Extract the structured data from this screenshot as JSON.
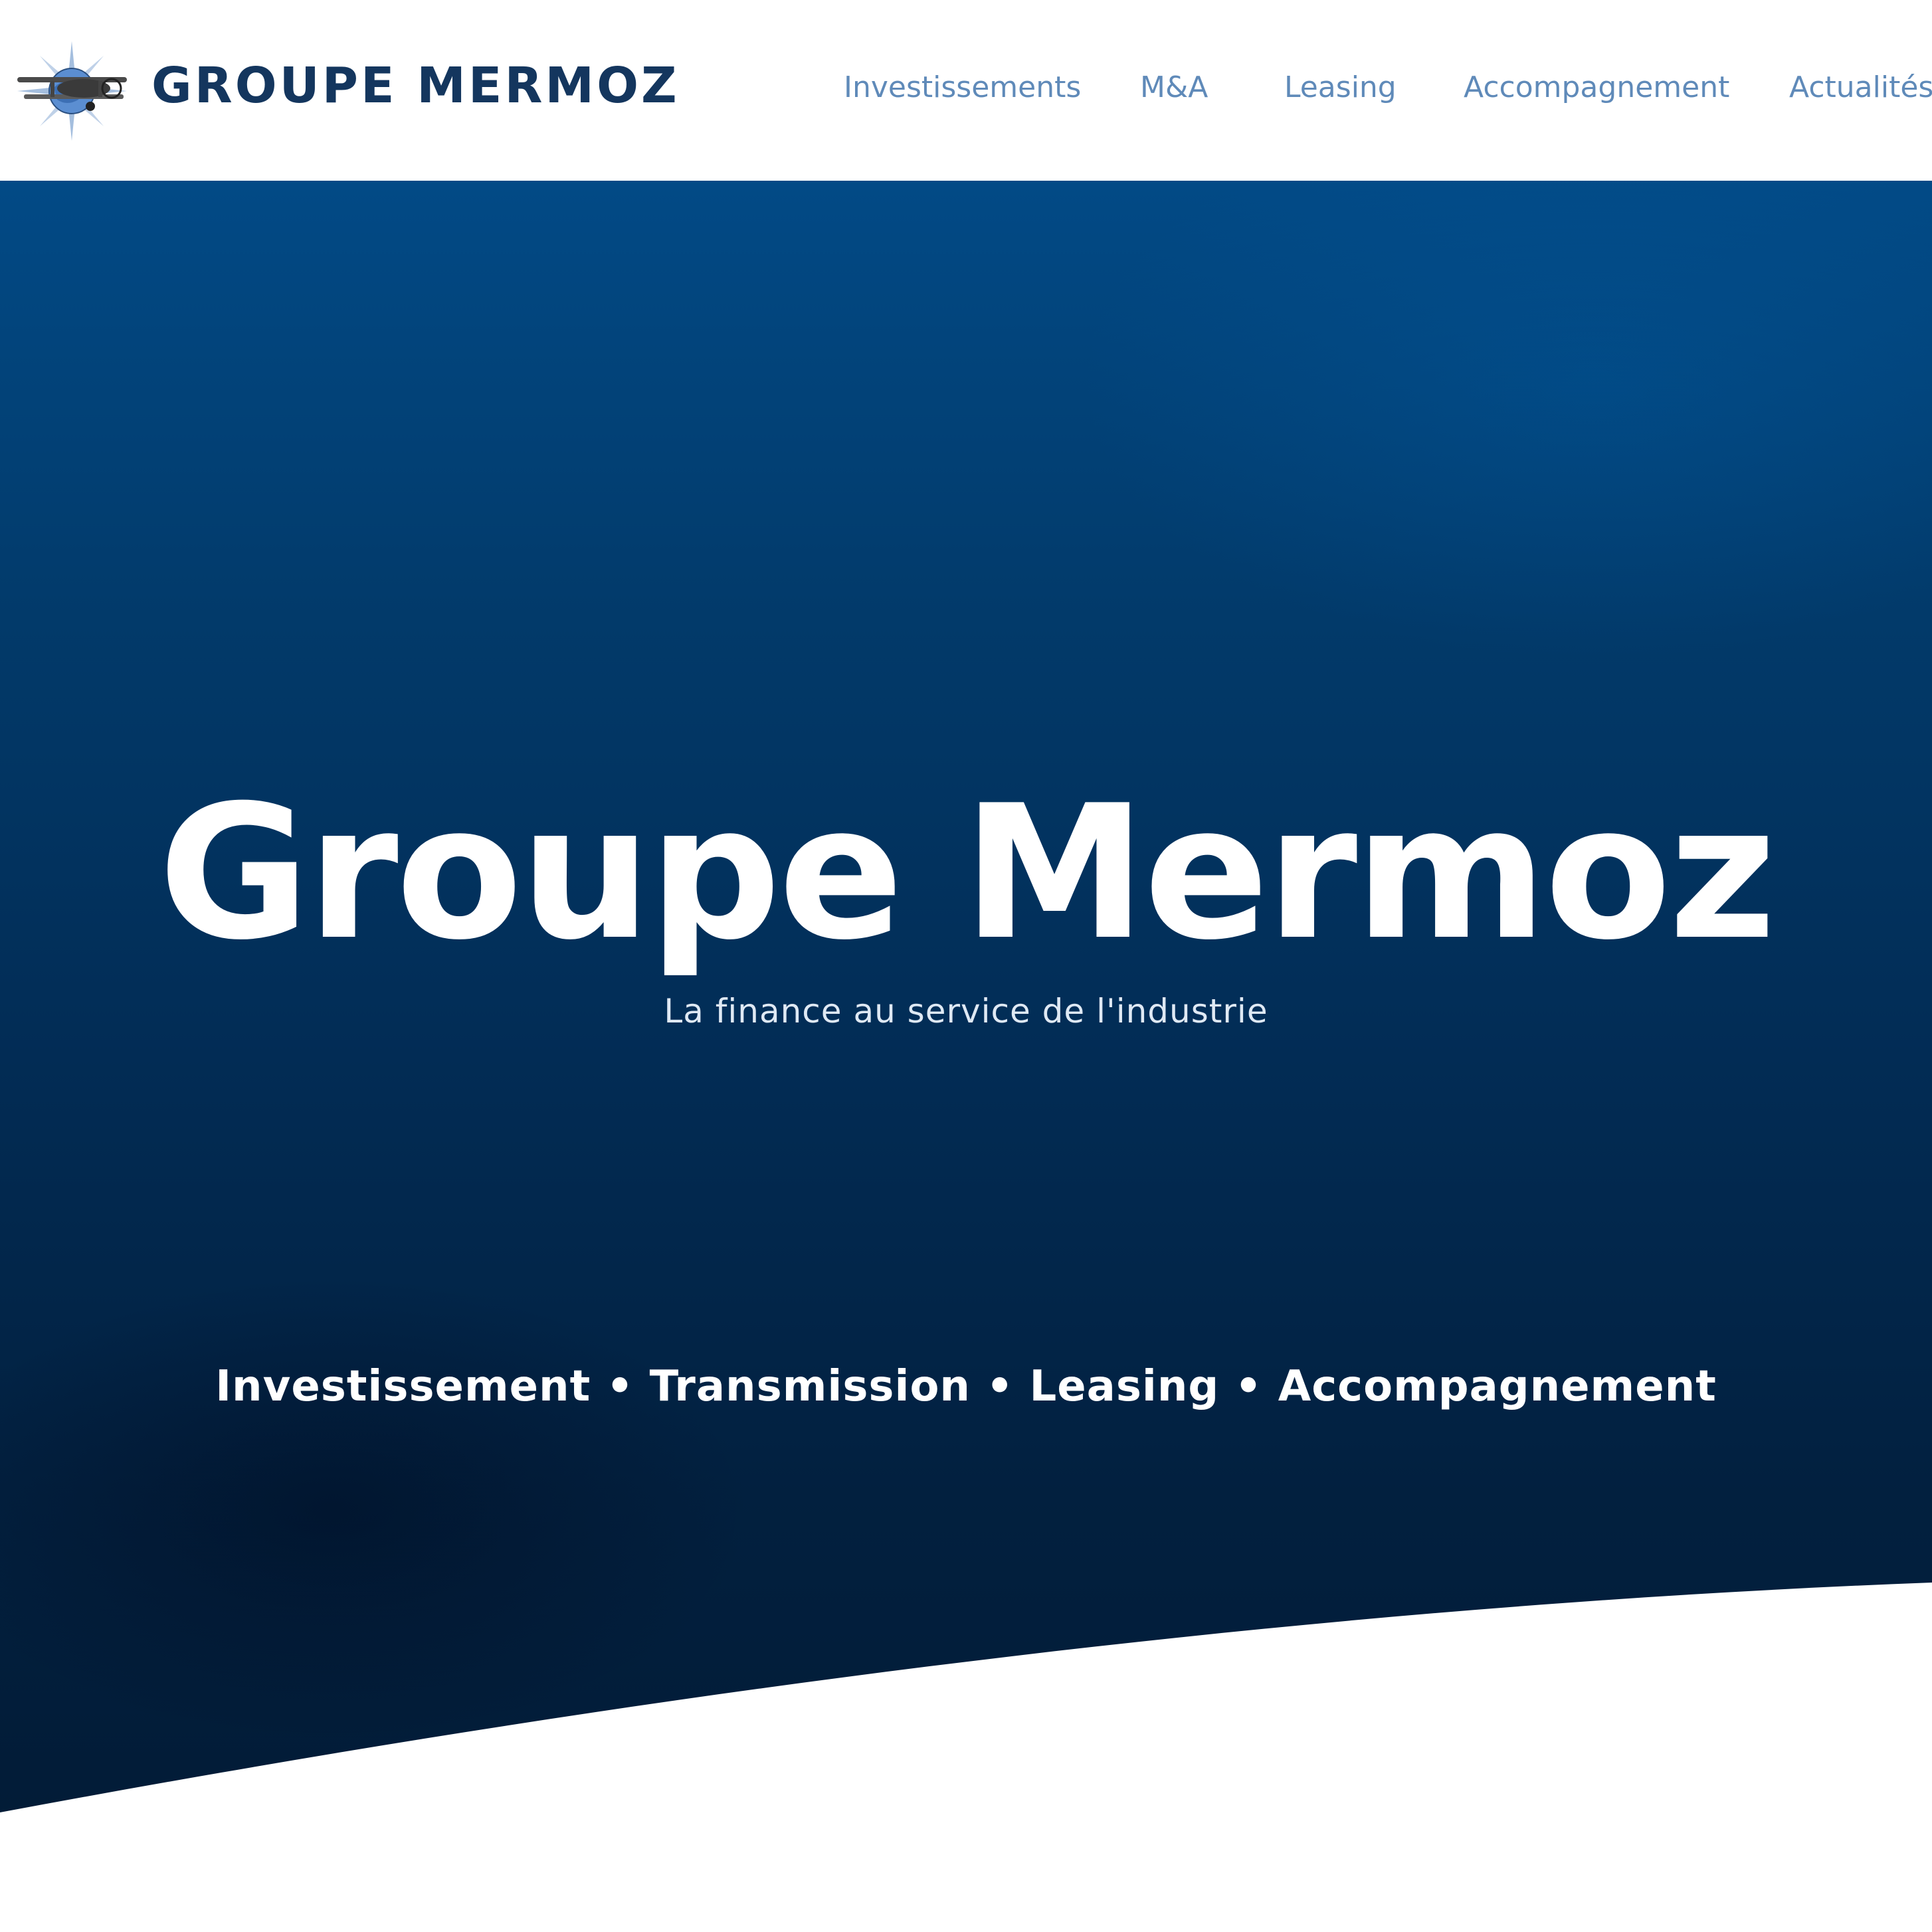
{
  "header": {
    "brand": "GROUPE MERMOZ",
    "logo_icon": "biplane-compass-icon",
    "nav": [
      {
        "label": "Investissements"
      },
      {
        "label": "M&A"
      },
      {
        "label": "Leasing"
      },
      {
        "label": "Accompagnement"
      },
      {
        "label": "Actualités"
      }
    ]
  },
  "hero": {
    "title": "Groupe Mermoz",
    "subtitle": "La finance au service de l'industrie",
    "services": "Investissement • Transmission • Leasing • Accompagnement"
  },
  "colors": {
    "brand_navy": "#14365e",
    "nav_blue": "#5f8ab9",
    "hero_top": "#024a86",
    "hero_bottom": "#021a34",
    "text_on_hero": "#ffffff"
  }
}
